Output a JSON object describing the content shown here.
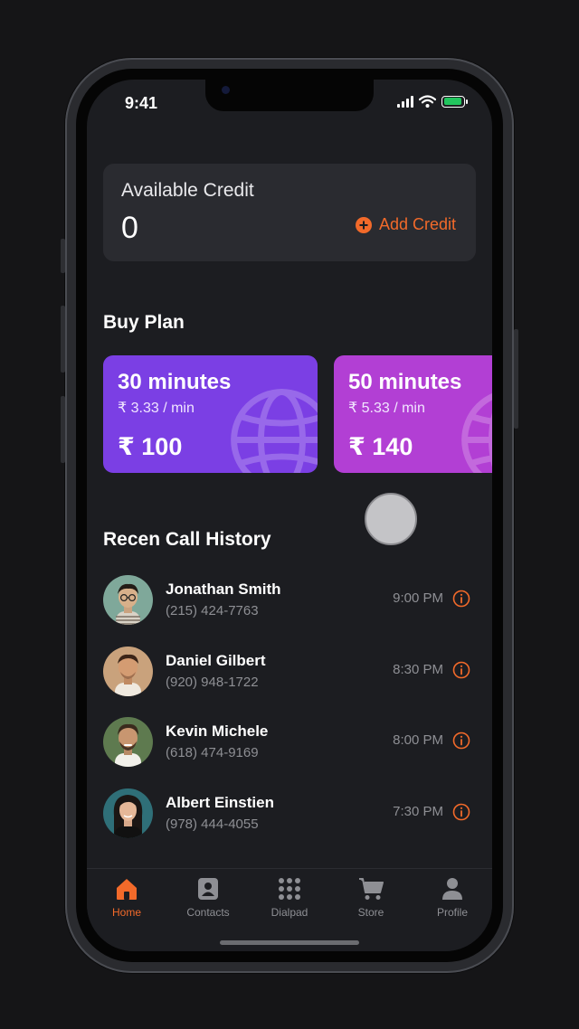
{
  "status_bar": {
    "time": "9:41"
  },
  "credit": {
    "title": "Available Credit",
    "value": "0",
    "add_label": "Add Credit"
  },
  "buy_plan": {
    "title": "Buy Plan",
    "plans": [
      {
        "minutes": "30 minutes",
        "rate": "₹ 3.33 / min",
        "price": "₹ 100",
        "color": "#7b3fe4"
      },
      {
        "minutes": "50 minutes",
        "rate": "₹ 5.33 / min",
        "price": "₹ 140",
        "color": "#b23fd4"
      }
    ]
  },
  "history": {
    "title": "Recen Call History",
    "calls": [
      {
        "name": "Jonathan Smith",
        "phone": "(215) 424-7763",
        "time": "9:00 PM"
      },
      {
        "name": "Daniel Gilbert",
        "phone": "(920) 948-1722",
        "time": "8:30 PM"
      },
      {
        "name": "Kevin Michele",
        "phone": "(618) 474-9169",
        "time": "8:00 PM"
      },
      {
        "name": "Albert Einstien",
        "phone": "(978) 444-4055",
        "time": "7:30 PM"
      }
    ]
  },
  "tabs": [
    {
      "label": "Home",
      "icon": "home-icon",
      "active": true
    },
    {
      "label": "Contacts",
      "icon": "contacts-icon"
    },
    {
      "label": "Dialpad",
      "icon": "dialpad-icon"
    },
    {
      "label": "Store",
      "icon": "cart-icon"
    },
    {
      "label": "Profile",
      "icon": "profile-icon"
    }
  ],
  "colors": {
    "accent": "#f26a2a",
    "background": "#1c1d21",
    "card": "#2a2b30"
  }
}
